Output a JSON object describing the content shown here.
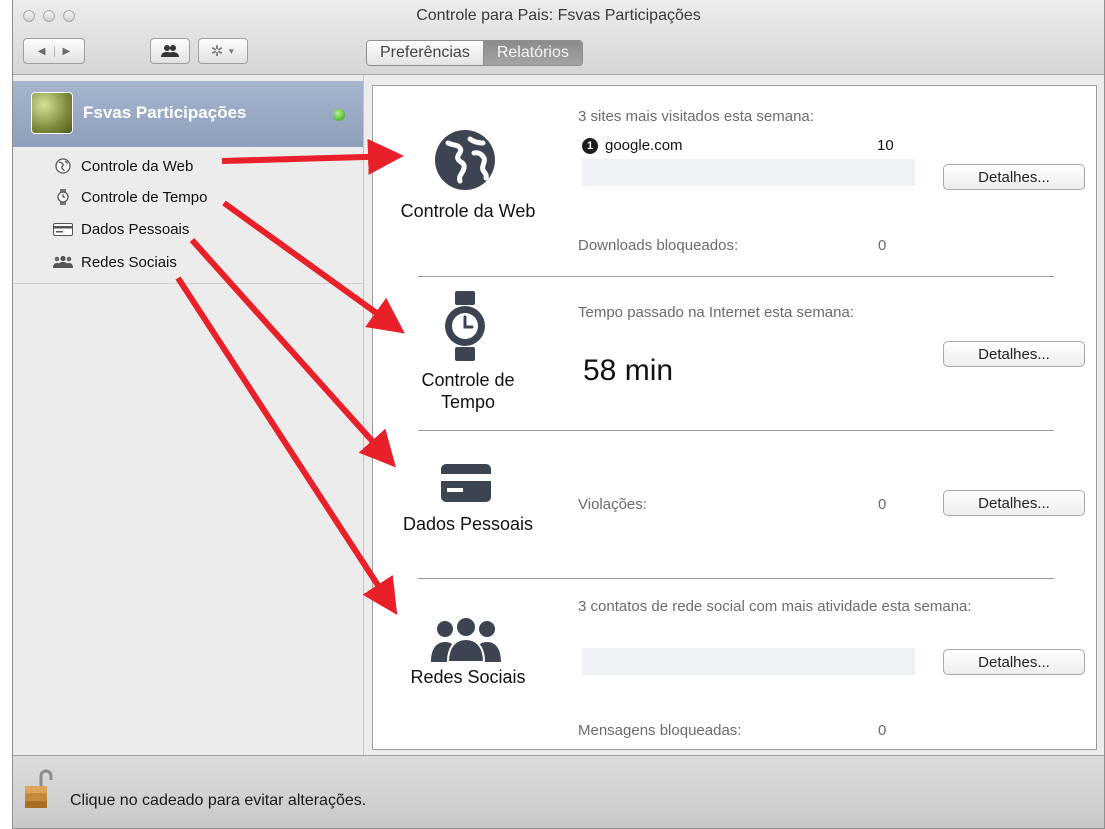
{
  "window": {
    "title": "Controle para Pais: Fsvas Participações"
  },
  "toolbar": {
    "nav_back_glyph": "◀",
    "nav_forward_glyph": "▶",
    "tabs": [
      {
        "label": "Preferências",
        "active": false
      },
      {
        "label": "Relatórios",
        "active": true
      }
    ]
  },
  "sidebar": {
    "user": {
      "name": "Fsvas Participações",
      "status_color": "#3aa81c"
    },
    "items": [
      {
        "label": "Controle da Web",
        "icon": "globe-icon"
      },
      {
        "label": "Controle de Tempo",
        "icon": "watch-icon"
      },
      {
        "label": "Dados Pessoais",
        "icon": "card-icon"
      },
      {
        "label": "Redes Sociais",
        "icon": "people-icon"
      }
    ]
  },
  "sections": {
    "web": {
      "title": "Controle da Web",
      "heading": "3 sites mais visitados esta semana:",
      "top_site": {
        "rank": "1",
        "name": "google.com",
        "count": "10"
      },
      "downloads_label": "Downloads bloqueados:",
      "downloads_value": "0",
      "button": "Detalhes..."
    },
    "time": {
      "title_line1": "Controle de",
      "title_line2": "Tempo",
      "heading": "Tempo passado na Internet esta semana:",
      "value": "58 min",
      "button": "Detalhes..."
    },
    "personal": {
      "title": "Dados Pessoais",
      "violations_label": "Violações:",
      "violations_value": "0",
      "button": "Detalhes..."
    },
    "social": {
      "title": "Redes Sociais",
      "heading": "3 contatos de rede social com mais atividade esta semana:",
      "blocked_label": "Mensagens bloqueadas:",
      "blocked_value": "0",
      "button": "Detalhes..."
    }
  },
  "footer": {
    "lock_text": "Clique no cadeado para evitar alterações."
  },
  "colors": {
    "icon_dark": "#3d4451",
    "annotation_arrow": "#e8202a",
    "sidebar_selected": "#98a8c3"
  }
}
